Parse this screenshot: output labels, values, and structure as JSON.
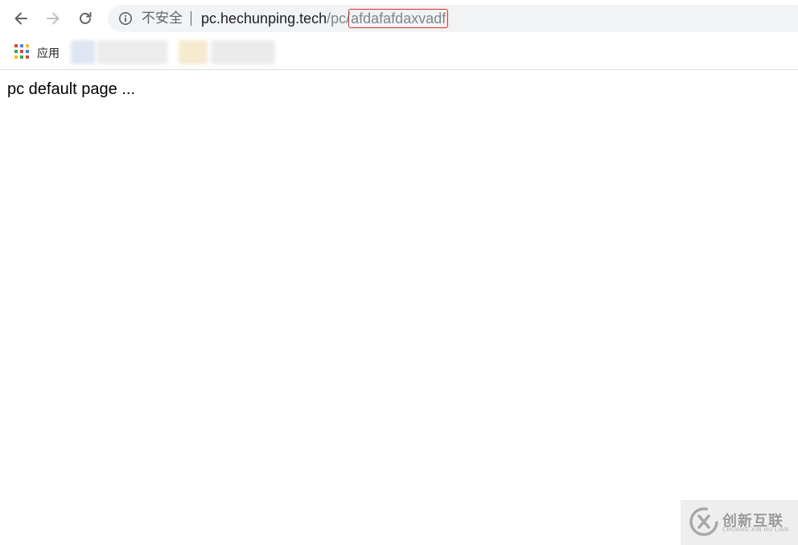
{
  "toolbar": {
    "back_icon": "arrow-left-icon",
    "forward_icon": "arrow-right-icon",
    "reload_icon": "reload-icon"
  },
  "omnibox": {
    "info_icon": "info-icon",
    "security_label": "不安全",
    "url_host": "pc.hechunping.tech",
    "url_path_prefix": "/pc/",
    "url_path_highlight": "afdafafdaxvadf",
    "highlight_color": "#d93025"
  },
  "bookmarks": {
    "apps_icon": "apps-grid-icon",
    "apps_label": "应用"
  },
  "page": {
    "body_text": "pc default page ..."
  },
  "watermark": {
    "brand_cn": "创新互联",
    "brand_en": "CHUANG XIN HU LIAN"
  }
}
